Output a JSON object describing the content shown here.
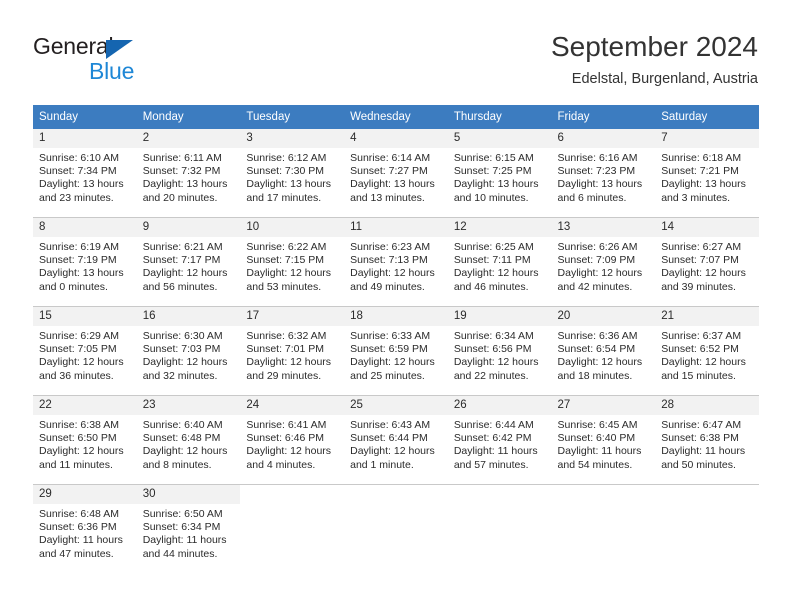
{
  "brand": {
    "name_part1": "General",
    "name_part2": "Blue",
    "triangle_color": "#1565b0",
    "blue_text_color": "#1e87d6"
  },
  "header": {
    "title": "September 2024",
    "location": "Edelstal, Burgenland, Austria"
  },
  "theme": {
    "header_background": "#3c7cc0",
    "header_text": "#ffffff",
    "daynumber_background": "#f2f2f2",
    "cell_border": "#c9c9c9",
    "body_text": "#2b2b2b"
  },
  "weekdays": [
    "Sunday",
    "Monday",
    "Tuesday",
    "Wednesday",
    "Thursday",
    "Friday",
    "Saturday"
  ],
  "weeks": [
    [
      {
        "day": "1",
        "sunrise": "Sunrise: 6:10 AM",
        "sunset": "Sunset: 7:34 PM",
        "daylight": "Daylight: 13 hours and 23 minutes."
      },
      {
        "day": "2",
        "sunrise": "Sunrise: 6:11 AM",
        "sunset": "Sunset: 7:32 PM",
        "daylight": "Daylight: 13 hours and 20 minutes."
      },
      {
        "day": "3",
        "sunrise": "Sunrise: 6:12 AM",
        "sunset": "Sunset: 7:30 PM",
        "daylight": "Daylight: 13 hours and 17 minutes."
      },
      {
        "day": "4",
        "sunrise": "Sunrise: 6:14 AM",
        "sunset": "Sunset: 7:27 PM",
        "daylight": "Daylight: 13 hours and 13 minutes."
      },
      {
        "day": "5",
        "sunrise": "Sunrise: 6:15 AM",
        "sunset": "Sunset: 7:25 PM",
        "daylight": "Daylight: 13 hours and 10 minutes."
      },
      {
        "day": "6",
        "sunrise": "Sunrise: 6:16 AM",
        "sunset": "Sunset: 7:23 PM",
        "daylight": "Daylight: 13 hours and 6 minutes."
      },
      {
        "day": "7",
        "sunrise": "Sunrise: 6:18 AM",
        "sunset": "Sunset: 7:21 PM",
        "daylight": "Daylight: 13 hours and 3 minutes."
      }
    ],
    [
      {
        "day": "8",
        "sunrise": "Sunrise: 6:19 AM",
        "sunset": "Sunset: 7:19 PM",
        "daylight": "Daylight: 13 hours and 0 minutes."
      },
      {
        "day": "9",
        "sunrise": "Sunrise: 6:21 AM",
        "sunset": "Sunset: 7:17 PM",
        "daylight": "Daylight: 12 hours and 56 minutes."
      },
      {
        "day": "10",
        "sunrise": "Sunrise: 6:22 AM",
        "sunset": "Sunset: 7:15 PM",
        "daylight": "Daylight: 12 hours and 53 minutes."
      },
      {
        "day": "11",
        "sunrise": "Sunrise: 6:23 AM",
        "sunset": "Sunset: 7:13 PM",
        "daylight": "Daylight: 12 hours and 49 minutes."
      },
      {
        "day": "12",
        "sunrise": "Sunrise: 6:25 AM",
        "sunset": "Sunset: 7:11 PM",
        "daylight": "Daylight: 12 hours and 46 minutes."
      },
      {
        "day": "13",
        "sunrise": "Sunrise: 6:26 AM",
        "sunset": "Sunset: 7:09 PM",
        "daylight": "Daylight: 12 hours and 42 minutes."
      },
      {
        "day": "14",
        "sunrise": "Sunrise: 6:27 AM",
        "sunset": "Sunset: 7:07 PM",
        "daylight": "Daylight: 12 hours and 39 minutes."
      }
    ],
    [
      {
        "day": "15",
        "sunrise": "Sunrise: 6:29 AM",
        "sunset": "Sunset: 7:05 PM",
        "daylight": "Daylight: 12 hours and 36 minutes."
      },
      {
        "day": "16",
        "sunrise": "Sunrise: 6:30 AM",
        "sunset": "Sunset: 7:03 PM",
        "daylight": "Daylight: 12 hours and 32 minutes."
      },
      {
        "day": "17",
        "sunrise": "Sunrise: 6:32 AM",
        "sunset": "Sunset: 7:01 PM",
        "daylight": "Daylight: 12 hours and 29 minutes."
      },
      {
        "day": "18",
        "sunrise": "Sunrise: 6:33 AM",
        "sunset": "Sunset: 6:59 PM",
        "daylight": "Daylight: 12 hours and 25 minutes."
      },
      {
        "day": "19",
        "sunrise": "Sunrise: 6:34 AM",
        "sunset": "Sunset: 6:56 PM",
        "daylight": "Daylight: 12 hours and 22 minutes."
      },
      {
        "day": "20",
        "sunrise": "Sunrise: 6:36 AM",
        "sunset": "Sunset: 6:54 PM",
        "daylight": "Daylight: 12 hours and 18 minutes."
      },
      {
        "day": "21",
        "sunrise": "Sunrise: 6:37 AM",
        "sunset": "Sunset: 6:52 PM",
        "daylight": "Daylight: 12 hours and 15 minutes."
      }
    ],
    [
      {
        "day": "22",
        "sunrise": "Sunrise: 6:38 AM",
        "sunset": "Sunset: 6:50 PM",
        "daylight": "Daylight: 12 hours and 11 minutes."
      },
      {
        "day": "23",
        "sunrise": "Sunrise: 6:40 AM",
        "sunset": "Sunset: 6:48 PM",
        "daylight": "Daylight: 12 hours and 8 minutes."
      },
      {
        "day": "24",
        "sunrise": "Sunrise: 6:41 AM",
        "sunset": "Sunset: 6:46 PM",
        "daylight": "Daylight: 12 hours and 4 minutes."
      },
      {
        "day": "25",
        "sunrise": "Sunrise: 6:43 AM",
        "sunset": "Sunset: 6:44 PM",
        "daylight": "Daylight: 12 hours and 1 minute."
      },
      {
        "day": "26",
        "sunrise": "Sunrise: 6:44 AM",
        "sunset": "Sunset: 6:42 PM",
        "daylight": "Daylight: 11 hours and 57 minutes."
      },
      {
        "day": "27",
        "sunrise": "Sunrise: 6:45 AM",
        "sunset": "Sunset: 6:40 PM",
        "daylight": "Daylight: 11 hours and 54 minutes."
      },
      {
        "day": "28",
        "sunrise": "Sunrise: 6:47 AM",
        "sunset": "Sunset: 6:38 PM",
        "daylight": "Daylight: 11 hours and 50 minutes."
      }
    ],
    [
      {
        "day": "29",
        "sunrise": "Sunrise: 6:48 AM",
        "sunset": "Sunset: 6:36 PM",
        "daylight": "Daylight: 11 hours and 47 minutes."
      },
      {
        "day": "30",
        "sunrise": "Sunrise: 6:50 AM",
        "sunset": "Sunset: 6:34 PM",
        "daylight": "Daylight: 11 hours and 44 minutes."
      },
      {
        "day": "",
        "sunrise": "",
        "sunset": "",
        "daylight": ""
      },
      {
        "day": "",
        "sunrise": "",
        "sunset": "",
        "daylight": ""
      },
      {
        "day": "",
        "sunrise": "",
        "sunset": "",
        "daylight": ""
      },
      {
        "day": "",
        "sunrise": "",
        "sunset": "",
        "daylight": ""
      },
      {
        "day": "",
        "sunrise": "",
        "sunset": "",
        "daylight": ""
      }
    ]
  ]
}
